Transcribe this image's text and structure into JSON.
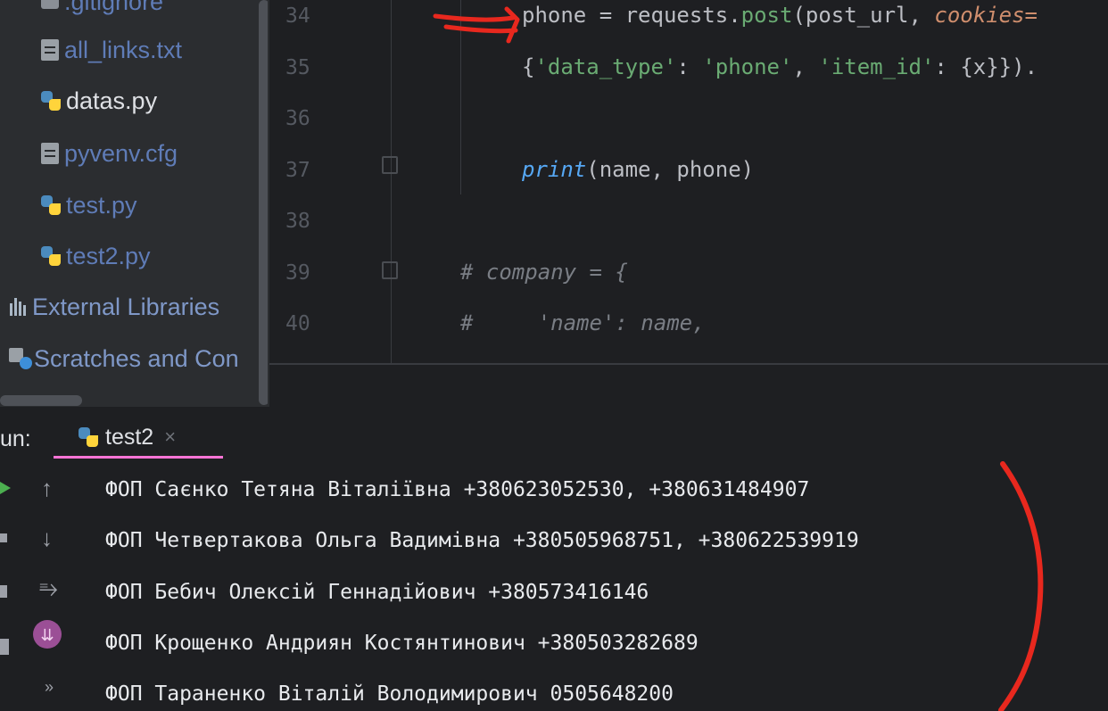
{
  "project_tree": {
    "items": [
      {
        "label": ".gitignore",
        "icon": "gitignore-file-icon"
      },
      {
        "label": "all_links.txt",
        "icon": "text-file-icon"
      },
      {
        "label": "datas.py",
        "icon": "python-file-icon"
      },
      {
        "label": "pyvenv.cfg",
        "icon": "text-file-icon"
      },
      {
        "label": "test.py",
        "icon": "python-file-icon"
      },
      {
        "label": "test2.py",
        "icon": "python-file-icon"
      },
      {
        "label": "External Libraries",
        "icon": "library-icon"
      },
      {
        "label": "Scratches and Con",
        "icon": "scratch-icon"
      }
    ]
  },
  "editor": {
    "line_numbers": [
      "34",
      "35",
      "36",
      "37",
      "38",
      "39",
      "40"
    ],
    "code": {
      "l34_var": "phone = requests.",
      "l34_post": "post",
      "l34_args": "(post_url, ",
      "l34_kw": "cookies=",
      "l35_open": "{",
      "l35_k1": "'data_type'",
      "l35_sep1": ": ",
      "l35_v1": "'phone'",
      "l35_sep2": ", ",
      "l35_k2": "'item_id'",
      "l35_rest": ": {x}}).",
      "l37_print": "print",
      "l37_args": "(name, phone)",
      "l39": "# company = {",
      "l40": "#     'name': name,"
    }
  },
  "run": {
    "label": "un:",
    "tab_label": "test2",
    "tab_close": "×",
    "output": [
      "ФОП Саєнко Тетяна Віталіївна +380623052530, +380631484907",
      "ФОП Четвертакова Ольга Вадимівна +380505968751, +380622539919",
      "ФОП Бебич Олексій Геннадійович +380573416146",
      "ФОП Крощенко Андриян Костянтинович +380503282689",
      "ФОП Тараненко Віталій Володимирович 0505648200"
    ],
    "tools": {
      "up": "↑",
      "down": "↓",
      "wrap": "⥱",
      "scroll_end": "⇊",
      "more": "»"
    }
  },
  "colors": {
    "annotation_red": "#e8281e",
    "tab_underline": "#ff74d6",
    "run_green": "#4caf50"
  }
}
